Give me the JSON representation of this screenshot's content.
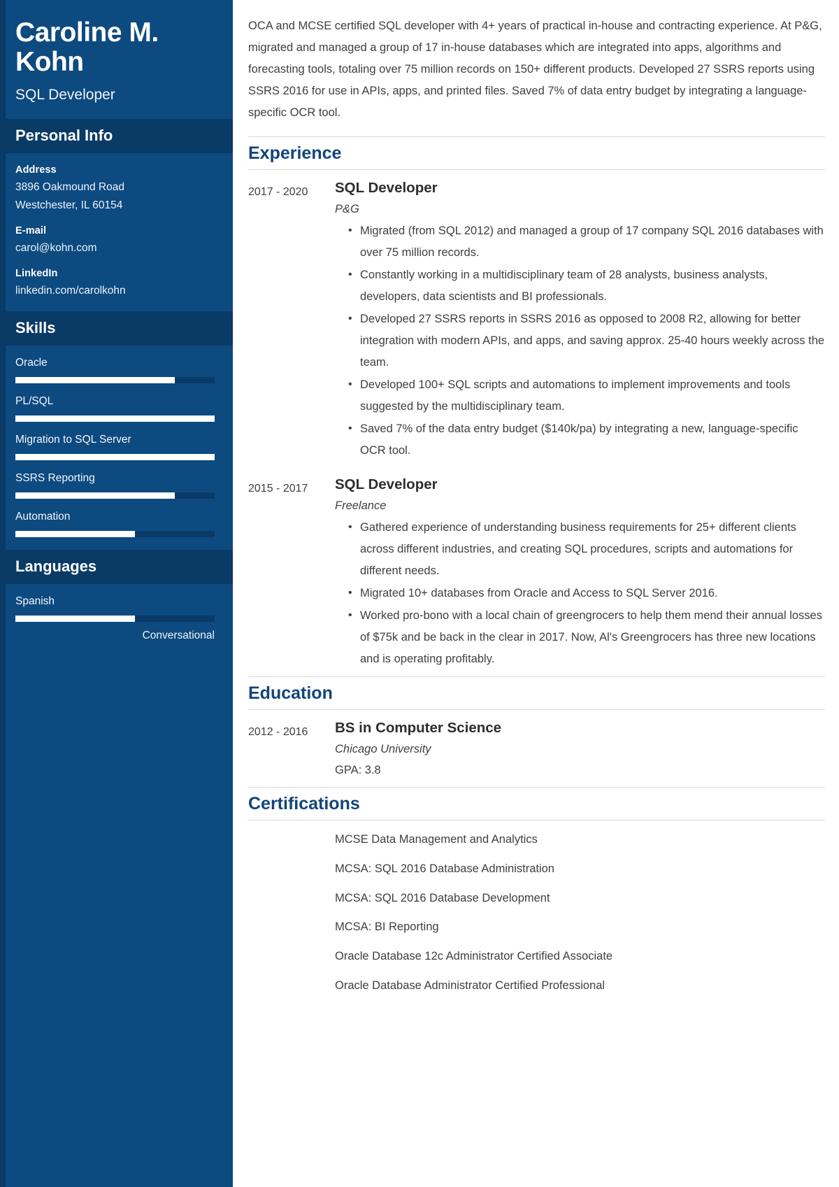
{
  "sidebar": {
    "full_name": "Caroline M. Kohn",
    "job_title": "SQL Developer",
    "personal_info": {
      "heading": "Personal Info",
      "groups": [
        {
          "label": "Address",
          "lines": [
            "3896 Oakmound Road",
            "Westchester, IL 60154"
          ]
        },
        {
          "label": "E-mail",
          "lines": [
            "carol@kohn.com"
          ]
        },
        {
          "label": "LinkedIn",
          "lines": [
            "linkedin.com/carolkohn"
          ]
        }
      ]
    },
    "skills": {
      "heading": "Skills",
      "items": [
        {
          "name": "Oracle",
          "level": 80
        },
        {
          "name": "PL/SQL",
          "level": 100
        },
        {
          "name": "Migration to SQL Server",
          "level": 100
        },
        {
          "name": "SSRS Reporting",
          "level": 80
        },
        {
          "name": "Automation",
          "level": 60
        }
      ]
    },
    "languages": {
      "heading": "Languages",
      "items": [
        {
          "name": "Spanish",
          "level": 60,
          "proficiency": "Conversational"
        }
      ]
    }
  },
  "main": {
    "summary": "OCA and MCSE certified SQL developer with 4+ years of practical in-house and contracting experience. At P&G, migrated and managed a group of 17 in-house databases which are integrated into apps, algorithms and forecasting tools, totaling over 75 million records on 150+ different products. Developed 27 SSRS reports using SSRS 2016 for use in APIs, apps, and printed files. Saved 7% of data entry budget by integrating a language-specific OCR tool.",
    "experience": {
      "heading": "Experience",
      "entries": [
        {
          "dates": "2017 - 2020",
          "role": "SQL Developer",
          "org": "P&G",
          "bullets": [
            "Migrated (from SQL 2012) and managed a group of 17 company SQL 2016 databases with over 75 million records.",
            "Constantly working in a multidisciplinary team of 28 analysts, business analysts, developers, data scientists and BI professionals.",
            "Developed 27 SSRS reports in SSRS 2016 as opposed to 2008 R2, allowing for better integration with modern APIs, and apps, and saving approx. 25-40 hours weekly across the team.",
            "Developed 100+ SQL scripts and automations to implement improvements and tools suggested by the multidisciplinary team.",
            "Saved 7% of the data entry budget ($140k/pa) by integrating a new, language-specific OCR tool."
          ]
        },
        {
          "dates": "2015 - 2017",
          "role": "SQL Developer",
          "org": "Freelance",
          "bullets": [
            "Gathered experience of understanding business requirements for 25+ different clients across different industries, and creating SQL procedures, scripts and automations for different needs.",
            "Migrated 10+ databases from Oracle and Access to SQL Server 2016.",
            "Worked pro-bono with a local chain of greengrocers to help them mend their annual losses of $75k and be back in the clear in 2017. Now, Al's Greengrocers has three new locations and is operating profitably."
          ]
        }
      ]
    },
    "education": {
      "heading": "Education",
      "entries": [
        {
          "dates": "2012 - 2016",
          "degree": "BS in Computer Science",
          "school": "Chicago University",
          "extra": "GPA: 3.8"
        }
      ]
    },
    "certifications": {
      "heading": "Certifications",
      "items": [
        "MCSE Data Management and Analytics",
        "MCSA: SQL 2016 Database Administration",
        "MCSA: SQL 2016 Database Development",
        "MCSA: BI Reporting",
        "Oracle Database 12c Administrator Certified Associate",
        "Oracle Database Administrator Certified Professional"
      ]
    }
  },
  "colors": {
    "sidebar_bg": "#0d4a80",
    "sidebar_accent": "#0a3a66",
    "heading_blue": "#11457c",
    "bar_fill": "#ffffff"
  }
}
